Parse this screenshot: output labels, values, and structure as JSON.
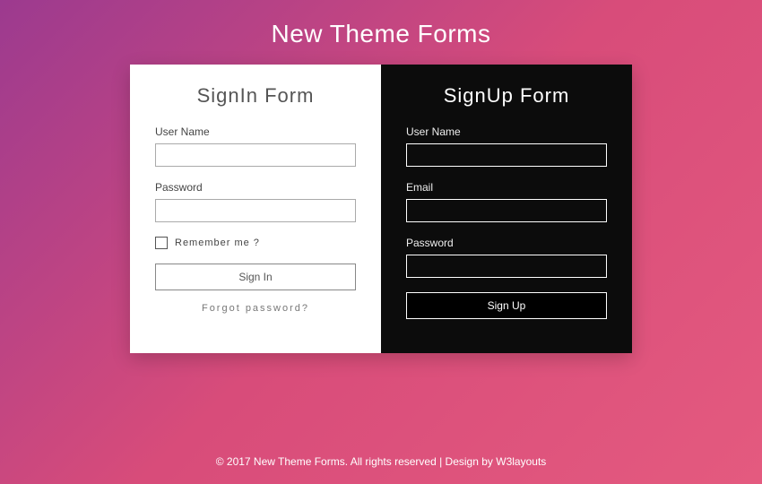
{
  "page": {
    "title": "New Theme Forms"
  },
  "signin": {
    "title": "SignIn Form",
    "username_label": "User Name",
    "password_label": "Password",
    "remember_label": "Remember me ?",
    "submit_label": "Sign In",
    "forgot_label": "Forgot password?"
  },
  "signup": {
    "title": "SignUp Form",
    "username_label": "User Name",
    "email_label": "Email",
    "password_label": "Password",
    "submit_label": "Sign Up"
  },
  "footer": {
    "copyright": "© 2017 New Theme Forms. All rights reserved | Design by ",
    "link_text": "W3layouts"
  }
}
